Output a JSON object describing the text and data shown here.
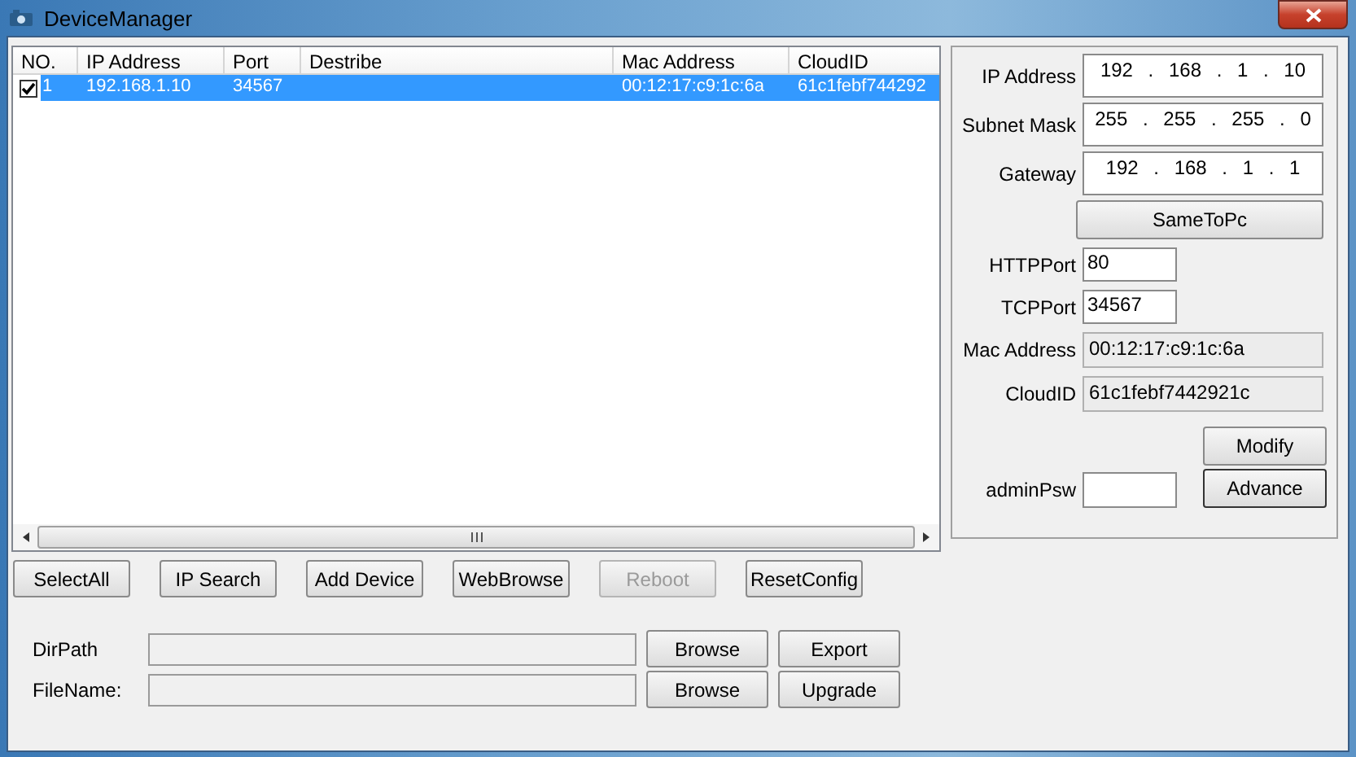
{
  "window": {
    "title": "DeviceManager"
  },
  "table": {
    "columns": [
      "NO.",
      "IP Address",
      "Port",
      "Destribe",
      "Mac Address",
      "CloudID"
    ],
    "rows": [
      {
        "checked": true,
        "selected": true,
        "cells": [
          "1",
          "192.168.1.10",
          "34567",
          "",
          "00:12:17:c9:1c:6a",
          "61c1febf744292"
        ]
      }
    ]
  },
  "actions": [
    {
      "label": "SelectAll",
      "disabled": false
    },
    {
      "label": "IP Search",
      "disabled": false
    },
    {
      "label": "Add Device",
      "disabled": false
    },
    {
      "label": "WebBrowse",
      "disabled": false
    },
    {
      "label": "Reboot",
      "disabled": true
    },
    {
      "label": "ResetConfig",
      "disabled": false
    }
  ],
  "files": [
    {
      "label": "DirPath",
      "browse": "Browse",
      "action": "Export"
    },
    {
      "label": "FileName:",
      "browse": "Browse",
      "action": "Upgrade"
    }
  ],
  "network": {
    "ip_fields": [
      {
        "label": "IP Address",
        "value": "192 . 168 . 1 . 10"
      },
      {
        "label": "Subnet Mask",
        "value": "255 . 255 . 255 . 0"
      },
      {
        "label": "Gateway",
        "value": "192 . 168 . 1 . 1"
      }
    ],
    "same_button": "SameToPc",
    "ports": [
      {
        "label": "HTTPPort",
        "value": "80"
      },
      {
        "label": "TCPPort",
        "value": "34567"
      }
    ],
    "info": [
      {
        "label": "Mac Address",
        "value": "00:12:17:c9:1c:6a"
      },
      {
        "label": "CloudID",
        "value": "61c1febf7442921c"
      }
    ],
    "modify": "Modify",
    "password_label": "adminPsw",
    "advance": "Advance"
  }
}
